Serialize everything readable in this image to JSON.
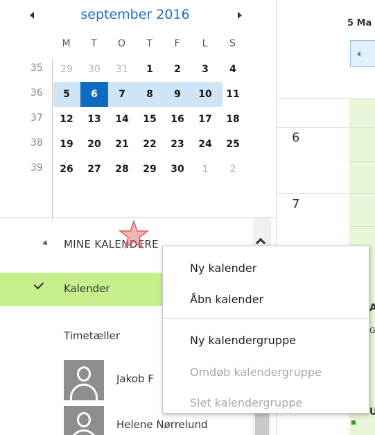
{
  "mini_calendar": {
    "month_title": "september 2016",
    "prev_icon": "triangle-left-icon",
    "next_icon": "triangle-right-icon",
    "weekdays": [
      "M",
      "T",
      "O",
      "T",
      "F",
      "L",
      "S"
    ],
    "weeks": [
      {
        "num": "35",
        "days": [
          {
            "d": "29",
            "other": true
          },
          {
            "d": "30",
            "other": true
          },
          {
            "d": "31",
            "other": true
          },
          {
            "d": "1"
          },
          {
            "d": "2"
          },
          {
            "d": "3"
          },
          {
            "d": "4"
          }
        ]
      },
      {
        "num": "36",
        "selected_week": true,
        "days": [
          {
            "d": "5"
          },
          {
            "d": "6",
            "today": true
          },
          {
            "d": "7"
          },
          {
            "d": "8"
          },
          {
            "d": "9"
          },
          {
            "d": "10"
          },
          {
            "d": "11"
          }
        ]
      },
      {
        "num": "37",
        "days": [
          {
            "d": "12"
          },
          {
            "d": "13"
          },
          {
            "d": "14"
          },
          {
            "d": "15"
          },
          {
            "d": "16"
          },
          {
            "d": "17"
          },
          {
            "d": "18"
          }
        ]
      },
      {
        "num": "38",
        "days": [
          {
            "d": "19"
          },
          {
            "d": "20"
          },
          {
            "d": "21"
          },
          {
            "d": "22"
          },
          {
            "d": "23"
          },
          {
            "d": "24"
          },
          {
            "d": "25"
          }
        ]
      },
      {
        "num": "39",
        "days": [
          {
            "d": "26"
          },
          {
            "d": "27"
          },
          {
            "d": "28"
          },
          {
            "d": "29"
          },
          {
            "d": "30"
          },
          {
            "d": "1",
            "other": true
          },
          {
            "d": "2",
            "other": true
          }
        ]
      }
    ]
  },
  "calendars": {
    "group_label": "MINE KALENDERE",
    "items": [
      {
        "label": "Kalender",
        "selected": true
      },
      {
        "label": "Timetæller"
      }
    ],
    "people": [
      {
        "name": "Jakob F"
      },
      {
        "name": "Helene Nørrelund"
      }
    ]
  },
  "context_menu": {
    "items": [
      {
        "label": "Ny kalender",
        "disabled": false
      },
      {
        "label": "Åbn kalender",
        "disabled": false
      },
      {
        "label": "Ny kalendergruppe",
        "disabled": false
      },
      {
        "label": "Omdøb kalendergruppe",
        "disabled": true
      },
      {
        "label": "Slet kalendergruppe",
        "disabled": true
      }
    ]
  },
  "day_view": {
    "date_header": "5 Ma",
    "hours": [
      "6",
      "7"
    ],
    "edge_chars": [
      "A",
      "G",
      "U"
    ]
  },
  "colors": {
    "accent_blue": "#1e6fc0",
    "today_bg": "#0f6bbf",
    "week_highlight": "#cfe4f5",
    "selected_calendar": "#c6ef8d",
    "day_column_green": "#eaf6d9"
  }
}
